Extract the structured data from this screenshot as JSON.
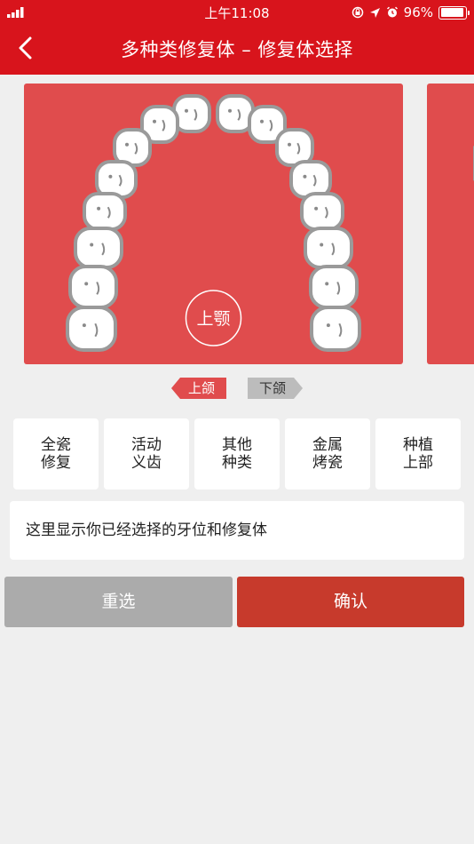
{
  "status_bar": {
    "time": "上午11:08",
    "battery": "96%",
    "battery_level": 0.96,
    "icons": [
      "signal-icon",
      "orientation-lock-icon",
      "location-icon",
      "alarm-icon",
      "battery-icon"
    ]
  },
  "nav": {
    "title": "多种类修复体 – 修复体选择",
    "back_icon": "chevron-left-icon"
  },
  "jaw": {
    "center_label": "上颚"
  },
  "jaw_tabs": [
    {
      "label": "上颌",
      "active": true
    },
    {
      "label": "下颌",
      "active": false
    }
  ],
  "restoration_types": [
    {
      "line1": "全瓷",
      "line2": "修复"
    },
    {
      "line1": "活动",
      "line2": "义齿"
    },
    {
      "line1": "其他",
      "line2": "种类"
    },
    {
      "line1": "金属",
      "line2": "烤瓷"
    },
    {
      "line1": "种植",
      "line2": "上部"
    }
  ],
  "selection_placeholder": "这里显示你已经选择的牙位和修复体",
  "buttons": {
    "reset": "重选",
    "confirm": "确认"
  },
  "colors": {
    "header": "#d8141c",
    "jaw_card": "#e04c4d",
    "tooth_fill": "#ffffff",
    "tooth_outline": "#9a9a9a",
    "confirm": "#c73a2c",
    "reset": "#ababab"
  }
}
